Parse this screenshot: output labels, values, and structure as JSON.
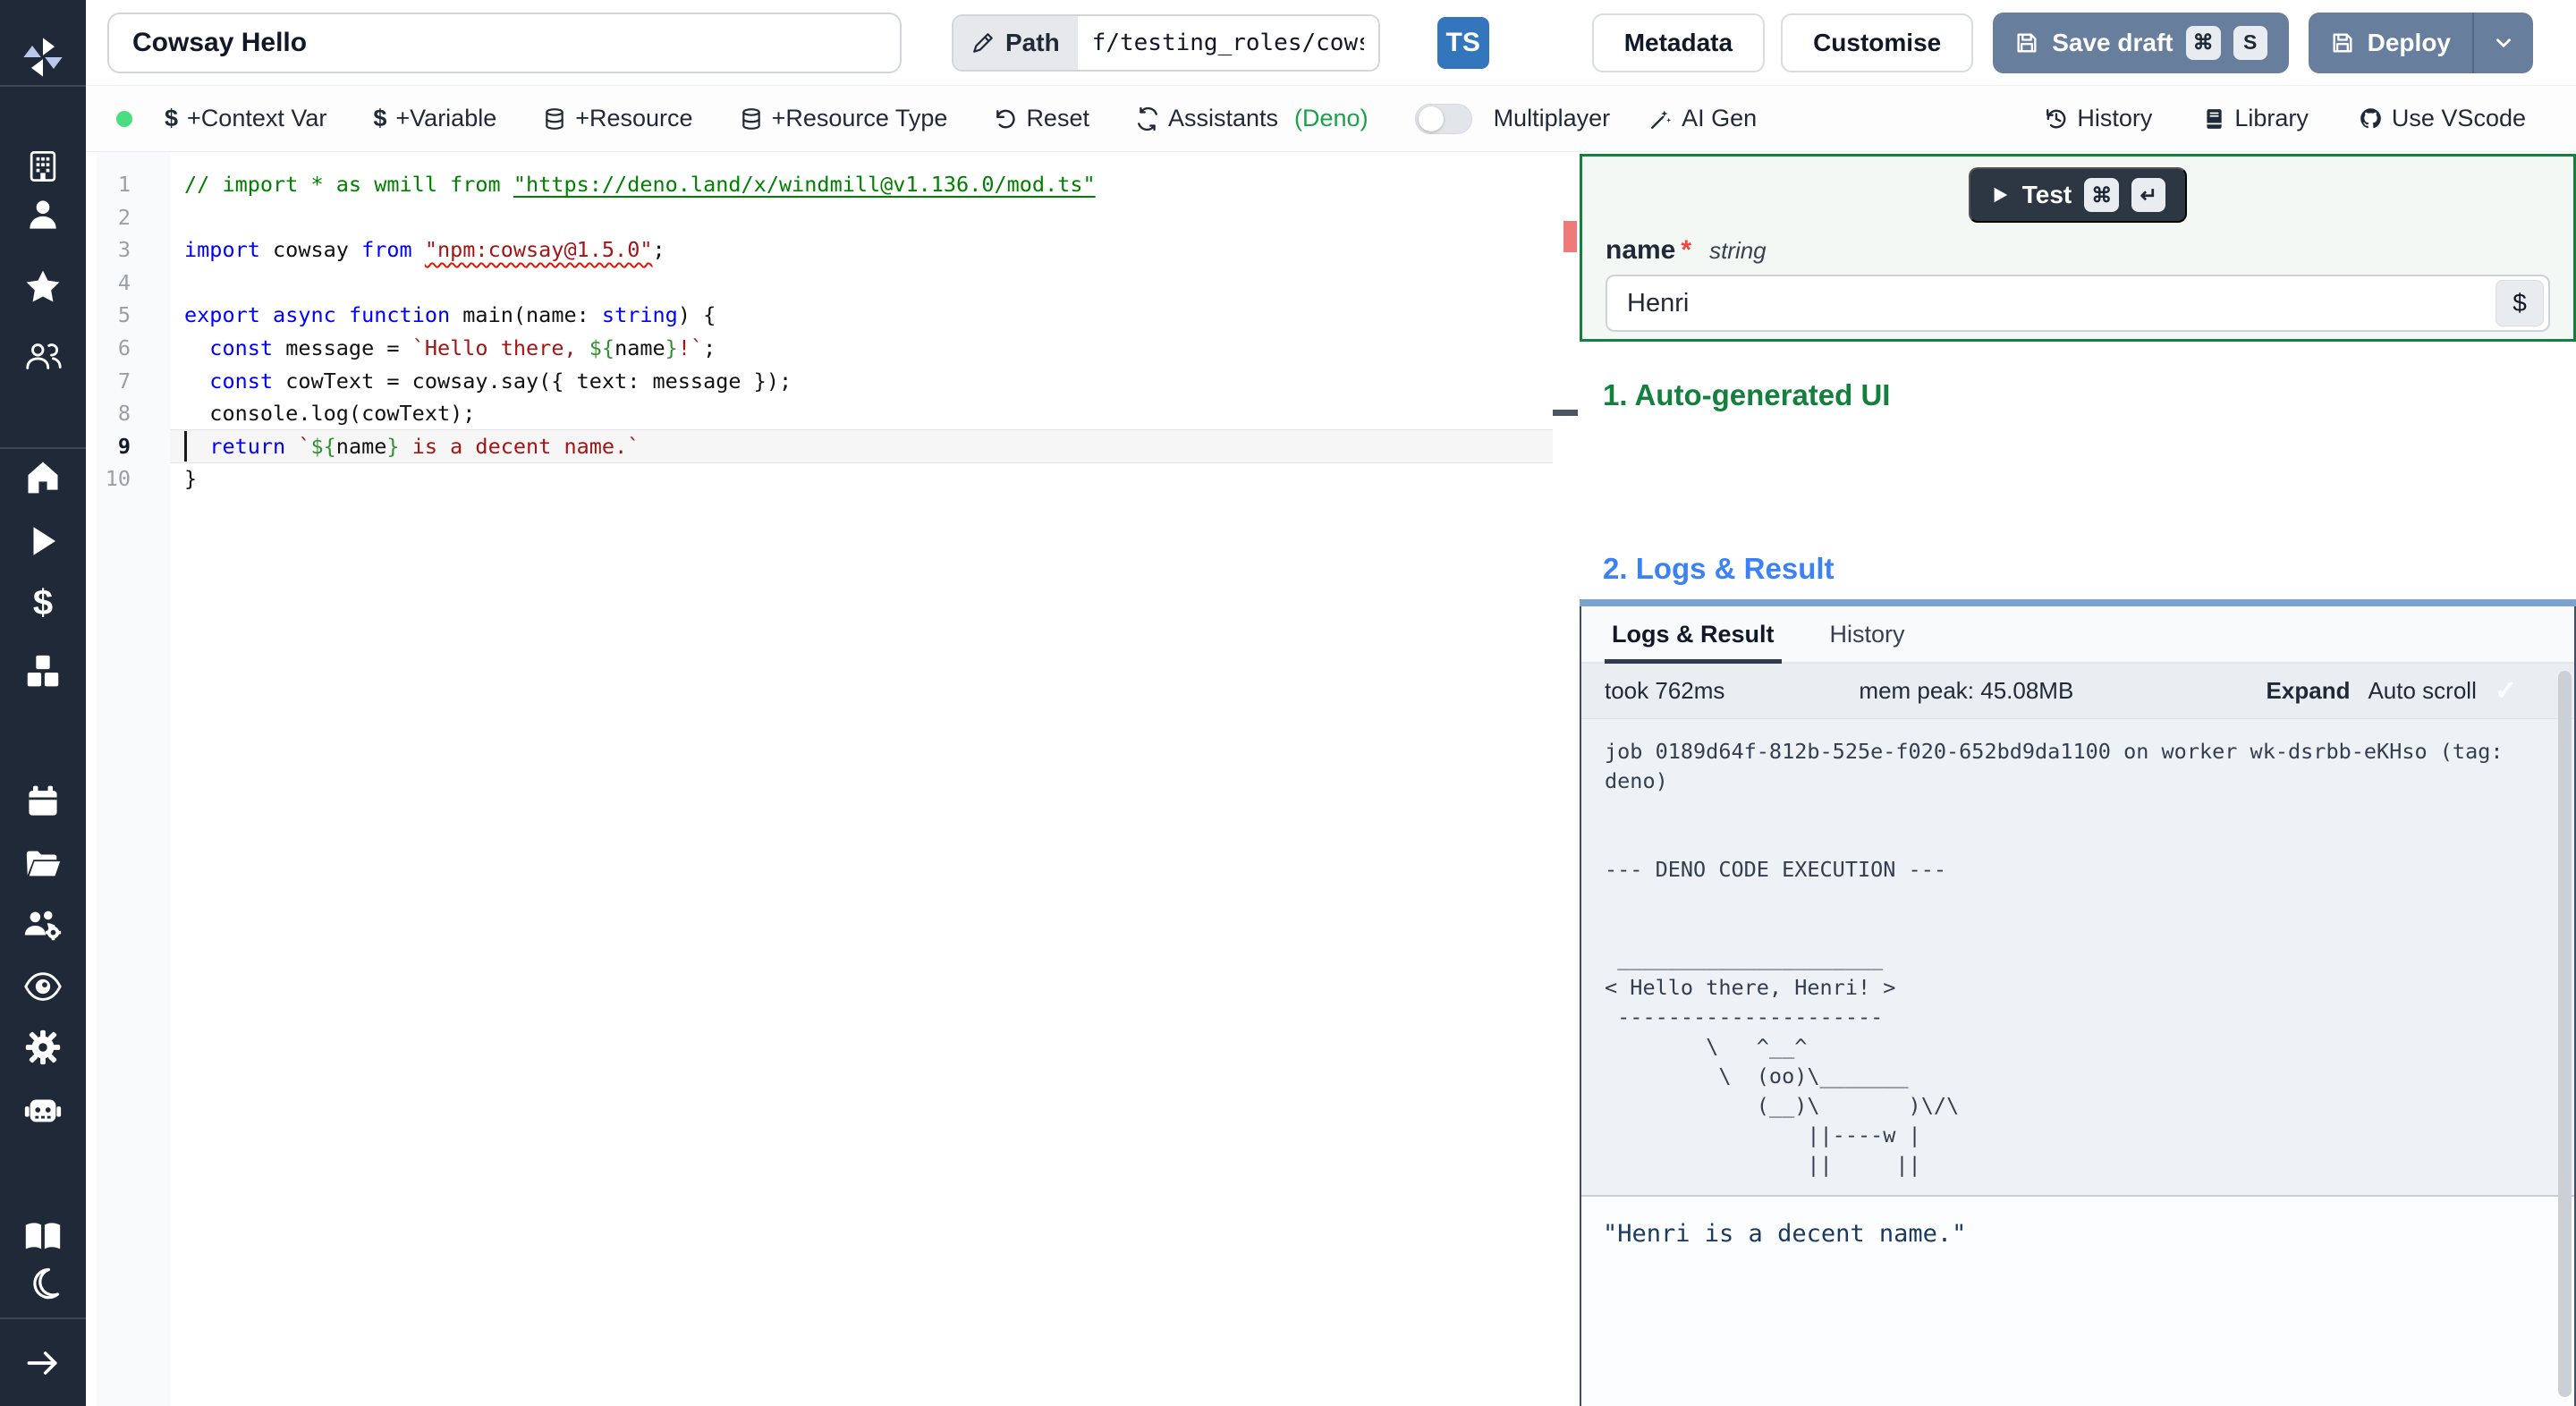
{
  "topbar": {
    "title": "Cowsay Hello",
    "path_label": "Path",
    "path_value": "f/testing_roles/cowsa",
    "lang_badge": "TS",
    "metadata_label": "Metadata",
    "customise_label": "Customise",
    "save_draft_label": "Save draft",
    "save_kbd1": "⌘",
    "save_kbd2": "S",
    "deploy_label": "Deploy"
  },
  "toolbar": {
    "context_var": "+Context Var",
    "variable": "+Variable",
    "resource": "+Resource",
    "resource_type": "+Resource Type",
    "reset": "Reset",
    "assistants": "Assistants",
    "assistants_lang": "(Deno)",
    "multiplayer": "Multiplayer",
    "ai_gen": "AI Gen",
    "history": "History",
    "library": "Library",
    "use_vscode": "Use VScode"
  },
  "sidebar": {
    "icons": [
      "windmill-logo",
      "workspace-building",
      "user",
      "favorites-star",
      "groups-users",
      "home",
      "runs-play",
      "variables-dollar",
      "resources-cubes",
      "schedules-calendar",
      "folders",
      "groups-settings",
      "audit-logs-eye",
      "settings-gear",
      "ai-robot",
      "docs-book",
      "dark-mode-moon",
      "expand-arrow"
    ]
  },
  "editor": {
    "active_line": 9,
    "lines": [
      {
        "n": 1,
        "t": [
          [
            "cm",
            "// import * as wmill from "
          ],
          [
            "cml",
            "\"https://deno.land/x/windmill@v1.136.0/mod.ts\""
          ]
        ]
      },
      {
        "n": 2,
        "t": []
      },
      {
        "n": 3,
        "t": [
          [
            "kw",
            "import"
          ],
          [
            "pl",
            " cowsay "
          ],
          [
            "kw",
            "from"
          ],
          [
            "pl",
            " "
          ],
          [
            "sqg",
            "\"npm:cowsay@1.5.0\""
          ],
          [
            "pl",
            ";"
          ]
        ]
      },
      {
        "n": 4,
        "t": []
      },
      {
        "n": 5,
        "t": [
          [
            "kw",
            "export"
          ],
          [
            "pl",
            " "
          ],
          [
            "kw",
            "async"
          ],
          [
            "pl",
            " "
          ],
          [
            "kw",
            "function"
          ],
          [
            "pl",
            " main("
          ],
          [
            "pl",
            "name"
          ],
          [
            "pl",
            ": "
          ],
          [
            "kw",
            "string"
          ],
          [
            "pl",
            ") {"
          ]
        ]
      },
      {
        "n": 6,
        "t": [
          [
            "pl",
            "  "
          ],
          [
            "kw",
            "const"
          ],
          [
            "pl",
            " message = "
          ],
          [
            "str",
            "`Hello there, "
          ],
          [
            "br",
            "${"
          ],
          [
            "pl",
            "name"
          ],
          [
            "br",
            "}"
          ],
          [
            "str",
            "!`"
          ],
          [
            "pl",
            ";"
          ]
        ]
      },
      {
        "n": 7,
        "t": [
          [
            "pl",
            "  "
          ],
          [
            "kw",
            "const"
          ],
          [
            "pl",
            " cowText = cowsay.say({ text: message });"
          ]
        ]
      },
      {
        "n": 8,
        "t": [
          [
            "pl",
            "  console.log(cowText);"
          ]
        ]
      },
      {
        "n": 9,
        "t": [
          [
            "pl",
            "  "
          ],
          [
            "kw",
            "return"
          ],
          [
            "pl",
            " "
          ],
          [
            "str",
            "`"
          ],
          [
            "br",
            "${"
          ],
          [
            "pl",
            "name"
          ],
          [
            "br",
            "}"
          ],
          [
            "str",
            " is a decent name.`"
          ]
        ]
      },
      {
        "n": 10,
        "t": [
          [
            "pl",
            "}"
          ]
        ]
      }
    ]
  },
  "run_panel": {
    "test_label": "Test",
    "kbd_cmd": "⌘",
    "kbd_enter": "↵",
    "field_name": "name",
    "required_mark": "*",
    "field_type": "string",
    "field_value": "Henri",
    "dollar_button": "$"
  },
  "sections": {
    "ui_heading": "1. Auto-generated UI",
    "logs_heading": "2. Logs & Result"
  },
  "logs": {
    "tab_logs": "Logs & Result",
    "tab_history": "History",
    "took": "took 762ms",
    "mem": "mem peak: 45.08MB",
    "expand_label": "Expand",
    "autoscroll_label": "Auto scroll",
    "check": "✓",
    "lines": [
      "job 0189d64f-812b-525e-f020-652bd9da1100 on worker wk-dsrbb-eKHso (tag:",
      "deno)",
      "",
      "",
      "--- DENO CODE EXECUTION ---",
      "",
      "",
      " _____________________",
      "< Hello there, Henri! >",
      " ---------------------",
      "        \\   ^__^",
      "         \\  (oo)\\_______",
      "            (__)\\       )\\/\\",
      "                ||----w |",
      "                ||     ||"
    ],
    "result": "\"Henri is a decent name.\""
  }
}
